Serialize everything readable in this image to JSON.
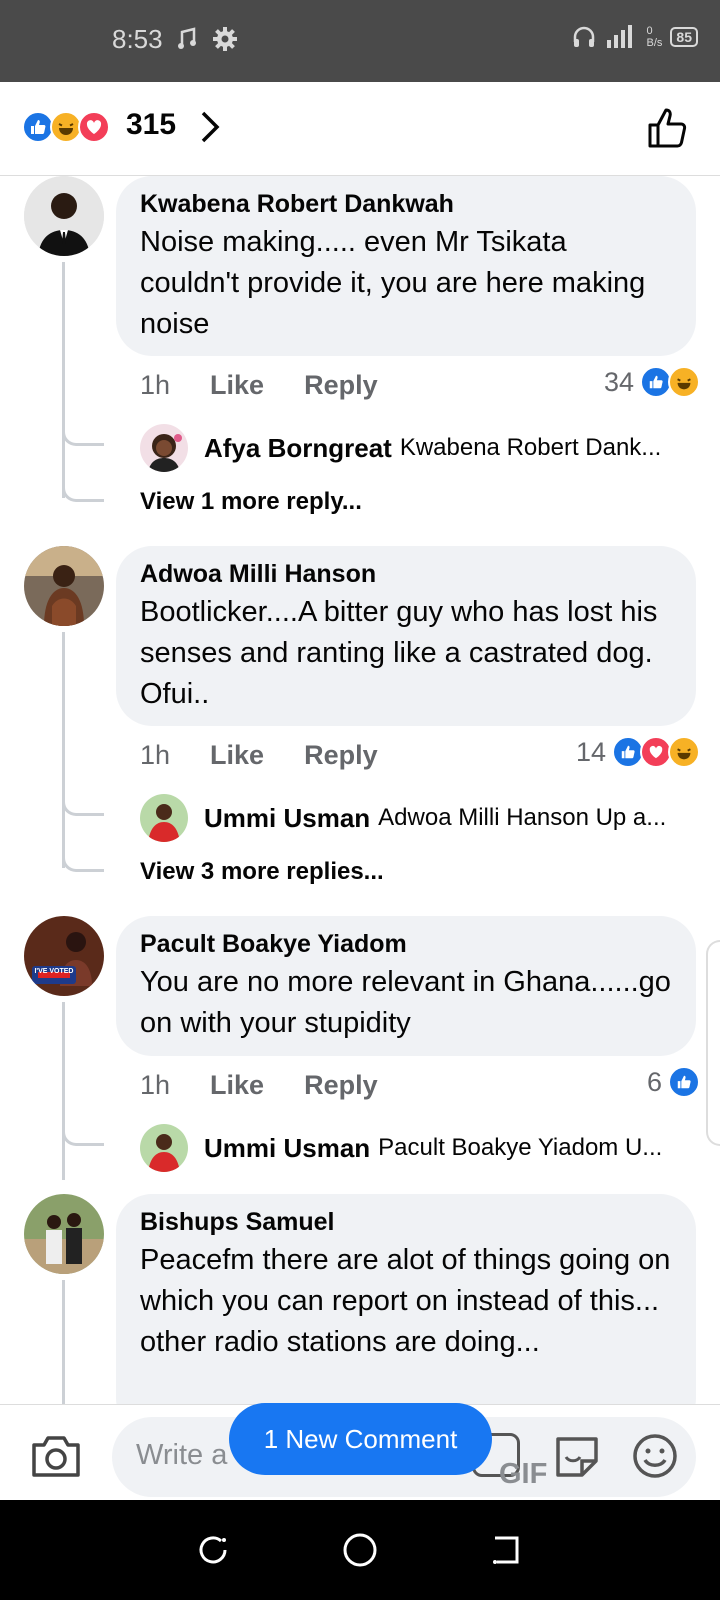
{
  "status_bar": {
    "time": "8:53",
    "network": "0\nB/s",
    "battery": "85"
  },
  "header": {
    "reaction_count": "315",
    "reactions": [
      "like",
      "haha",
      "love"
    ]
  },
  "comments": [
    {
      "author": "Kwabena Robert Dankwah",
      "text": "Noise making..... even Mr Tsikata couldn't provide it, you are here making noise",
      "time": "1h",
      "like": "Like",
      "reply": "Reply",
      "reaction_count": "34",
      "reactions": [
        "like",
        "haha"
      ],
      "reply_preview": {
        "author": "Afya Borngreat",
        "text": "Kwabena Robert Dank..."
      },
      "view_more": "View 1 more reply..."
    },
    {
      "author": "Adwoa Milli Hanson",
      "text": "Bootlicker....A bitter guy who has lost his senses and ranting like a castrated dog. Ofui..",
      "time": "1h",
      "like": "Like",
      "reply": "Reply",
      "reaction_count": "14",
      "reactions": [
        "like",
        "love",
        "haha"
      ],
      "reply_preview": {
        "author": "Ummi Usman",
        "text": "Adwoa Milli Hanson Up a..."
      },
      "view_more": "View 3 more replies..."
    },
    {
      "author": "Pacult Boakye Yiadom",
      "text": "You are no more relevant in Ghana......go on with your stupidity",
      "time": "1h",
      "like": "Like",
      "reply": "Reply",
      "reaction_count": "6",
      "reactions": [
        "like"
      ],
      "reply_preview": {
        "author": "Ummi Usman",
        "text": "Pacult Boakye Yiadom U..."
      }
    },
    {
      "author": "Bishups Samuel",
      "text": "Peacefm there are alot of things going on which you can report on instead of this... other radio stations are doing..."
    }
  ],
  "avatar_badge": "I'VE VOTED",
  "new_comment_button": "1 New Comment",
  "composer": {
    "placeholder": "Write a comment...",
    "gif_label": "GIF"
  },
  "colors": {
    "accent": "#1877f2",
    "like": "#1b74e4",
    "love": "#f33e58",
    "haha": "#f7b125",
    "bubble": "#f0f2f5"
  }
}
